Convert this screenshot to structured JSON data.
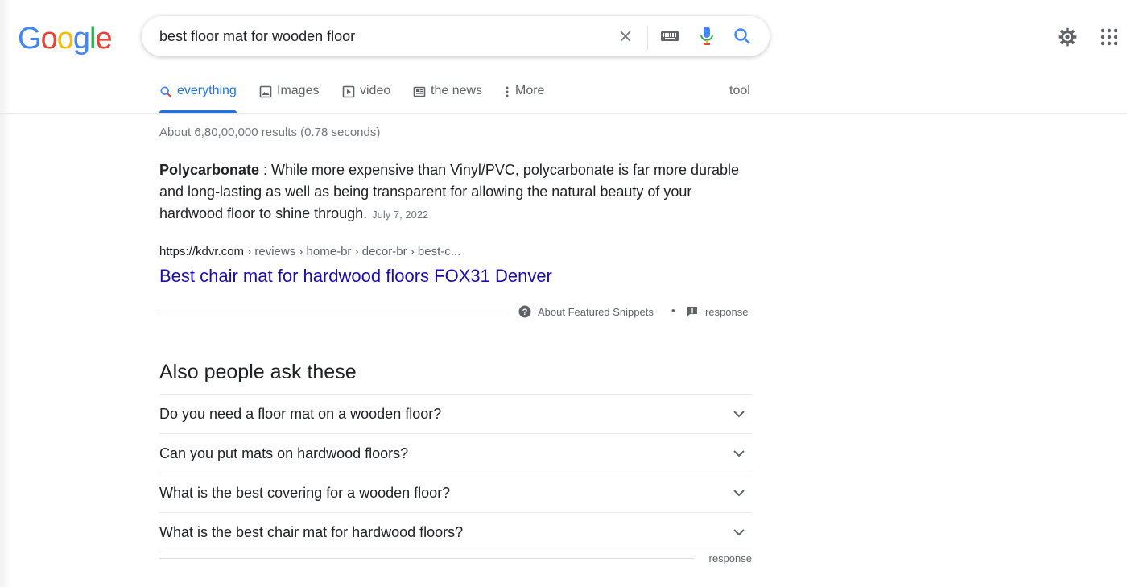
{
  "header": {
    "logo_letters": [
      {
        "ch": "G",
        "color": "#4285F4"
      },
      {
        "ch": "o",
        "color": "#EA4335"
      },
      {
        "ch": "o",
        "color": "#FBBC05"
      },
      {
        "ch": "g",
        "color": "#4285F4"
      },
      {
        "ch": "l",
        "color": "#34A853"
      },
      {
        "ch": "e",
        "color": "#EA4335"
      }
    ],
    "search_value": "best floor mat for wooden floor",
    "icons": [
      "close-icon",
      "keyboard-icon",
      "microphone-icon",
      "search-icon",
      "settings-gear-icon",
      "apps-grid-icon"
    ]
  },
  "tabs": [
    {
      "label": "everything",
      "icon": "search-icon",
      "active": true
    },
    {
      "label": "Images",
      "icon": "image-icon",
      "active": false
    },
    {
      "label": "video",
      "icon": "video-icon",
      "active": false
    },
    {
      "label": "the news",
      "icon": "news-icon",
      "active": false
    },
    {
      "label": "More",
      "icon": "more-vert-icon",
      "active": false
    }
  ],
  "tools_label": "tool",
  "stats": "About 6,80,00,000 results (0.78 seconds)",
  "featured_snippet": {
    "bold": "Polycarbonate",
    "text": " : While more expensive than Vinyl/PVC, polycarbonate is far more durable and long-lasting as well as being transparent for allowing the natural beauty of your hardwood floor to shine through.",
    "date": "July 7, 2022",
    "url_domain": "https://kdvr.com",
    "url_path": " › reviews › home-br › decor-br › best-c...",
    "title": "Best chair mat for hardwood floors FOX31 Denver",
    "about_label": "About Featured Snippets",
    "dot": "•",
    "feedback_label": "response"
  },
  "people_also_ask": {
    "heading": "Also people ask these",
    "questions": [
      "Do you need a floor mat on a wooden floor?",
      "Can you put mats on hardwood floors?",
      "What is the best covering for a wooden floor?",
      "What is the best chair mat for hardwood floors?"
    ],
    "feedback_label": "response"
  },
  "colors": {
    "accent": "#1a73e8",
    "link": "#1a0dab",
    "muted": "#70757a"
  }
}
